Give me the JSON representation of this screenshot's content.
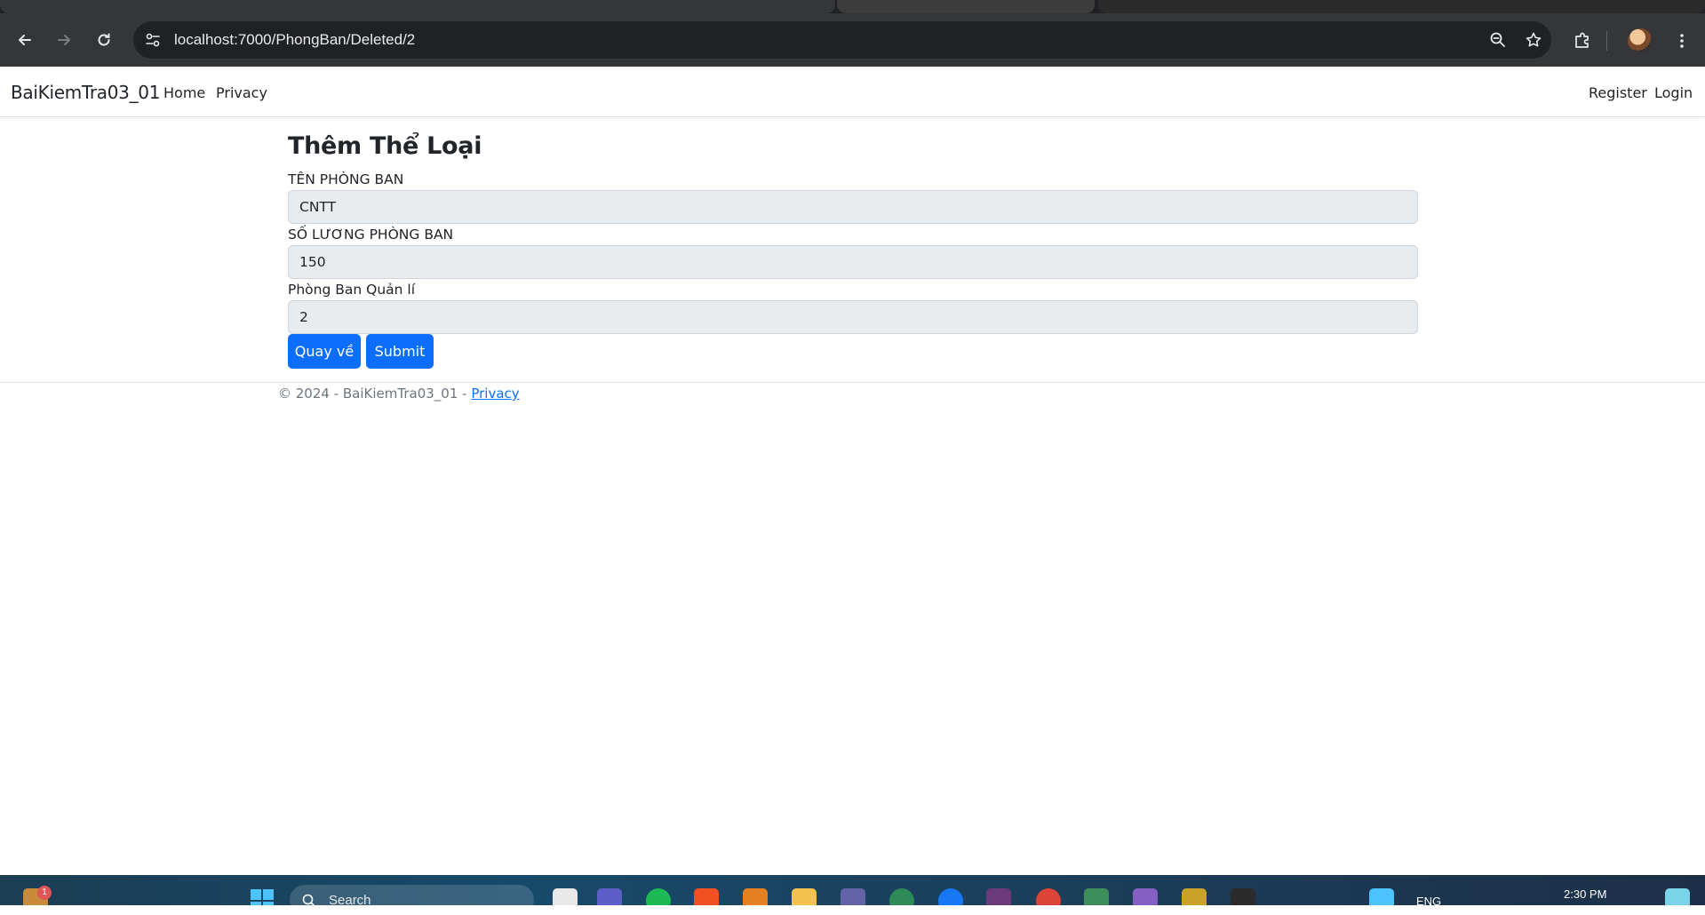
{
  "browser": {
    "url": "localhost:7000/PhongBan/Deleted/2"
  },
  "navbar": {
    "brand": "BaiKiemTra03_01",
    "links": [
      "Home",
      "Privacy"
    ],
    "right_links": [
      "Register",
      "Login"
    ]
  },
  "form": {
    "heading": "Thêm Thể Loại",
    "fields": [
      {
        "label": "TÊN PHÒNG BAN",
        "value": "CNTT"
      },
      {
        "label": "SỐ LƯƠNG PHÒNG BAN",
        "value": "150"
      },
      {
        "label": "Phòng Ban Quản lí",
        "value": "2"
      }
    ],
    "back_button": "Quay về",
    "submit_button": "Submit"
  },
  "footer": {
    "text": "© 2024 - BaiKiemTra03_01 - ",
    "link": "Privacy"
  },
  "taskbar": {
    "search_placeholder": "Search",
    "language": "ENG",
    "time": "2:30 PM",
    "notification_count": "1"
  }
}
